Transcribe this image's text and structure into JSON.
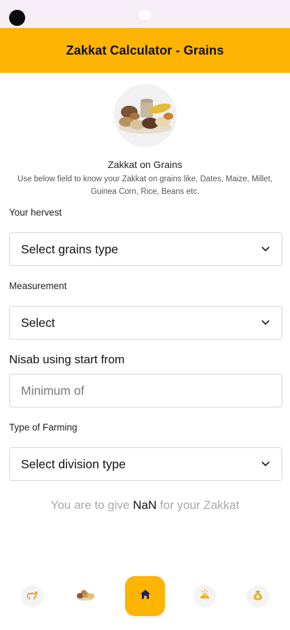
{
  "header": {
    "title": "Zakkat Calculator - Grains"
  },
  "intro": {
    "title": "Zakkat on Grains",
    "description": "Use below field to know your Zakkat on grains like, Dates, Maize, Millet, Guinea Corn, Rice, Beans etc.",
    "image_icon": "grains-image"
  },
  "form": {
    "harvest": {
      "label": "Your hervest",
      "value": "Select grains type"
    },
    "measurement": {
      "label": "Measurement",
      "value": "Select"
    },
    "nisab": {
      "label": "Nisab using start from",
      "placeholder": "Minimum of"
    },
    "farming": {
      "label": "Type of Farming",
      "value": "Select division type"
    }
  },
  "result": {
    "prefix": "You are to give",
    "amount": "NaN",
    "suffix": "for your Zakkat"
  },
  "nav": {
    "items": [
      {
        "icon": "camel-icon"
      },
      {
        "icon": "grains-icon"
      },
      {
        "icon": "home-icon"
      },
      {
        "icon": "gold-icon"
      },
      {
        "icon": "money-bag-icon"
      }
    ]
  },
  "colors": {
    "accent": "#fdb402",
    "home_icon": "#1c1f6e"
  }
}
